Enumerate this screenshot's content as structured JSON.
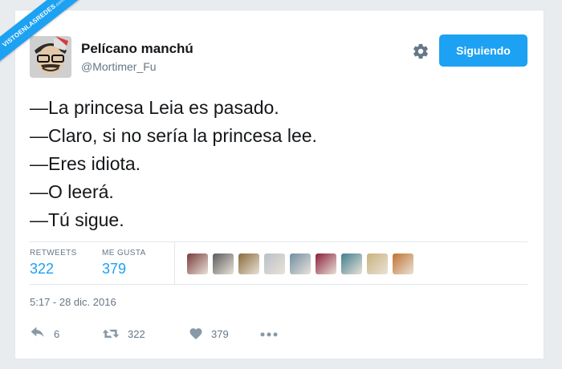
{
  "watermark": {
    "line1": "VISTOENLASREDES",
    "line2": ".com"
  },
  "tweet": {
    "display_name": "Pelícano manchú",
    "handle": "@Mortimer_Fu",
    "follow_label": "Siguiendo",
    "lines": [
      "—La princesa Leia es pasado.",
      "—Claro, si no sería la princesa lee.",
      "—Eres idiota.",
      "—O leerá.",
      "—Tú sigue."
    ],
    "stats": {
      "retweets_label": "RETWEETS",
      "retweets_value": "322",
      "likes_label": "ME GUSTA",
      "likes_value": "379"
    },
    "timestamp": "5:17 - 28 dic. 2016",
    "actions": {
      "reply_count": "6",
      "retweet_count": "322",
      "like_count": "379"
    }
  },
  "colors": {
    "accent": "#1da1f2",
    "text": "#14171a",
    "muted": "#657786",
    "liker_thumbs": [
      "#7a3b3b",
      "#5c5c5c",
      "#8a6a3a",
      "#b9c0c8",
      "#6f8fa3",
      "#8a1f3a",
      "#3f7f8f",
      "#c9b27c",
      "#c0712f"
    ]
  }
}
